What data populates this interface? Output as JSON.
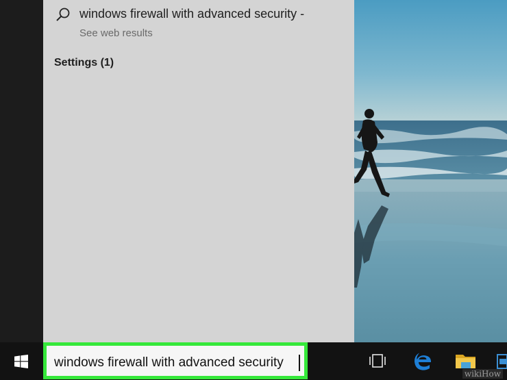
{
  "search_results": {
    "web_result": {
      "icon": "search-icon",
      "title": "windows firewall with advanced security -",
      "subtitle": "See web results"
    },
    "settings_heading": "Settings (1)"
  },
  "taskbar": {
    "start_icon": "windows-logo-icon",
    "search_box": {
      "value": "windows firewall with advanced security",
      "highlight_color": "#35e83a"
    },
    "pinned": [
      {
        "name": "task-view-icon"
      },
      {
        "name": "edge-icon"
      },
      {
        "name": "file-explorer-icon"
      },
      {
        "name": "store-icon"
      }
    ]
  },
  "watermark": "wikiHow",
  "colors": {
    "search_pane_bg": "#d4d4d4",
    "taskbar_bg": "#121212",
    "highlight": "#35e83a",
    "edge_blue": "#1e7fd6"
  }
}
